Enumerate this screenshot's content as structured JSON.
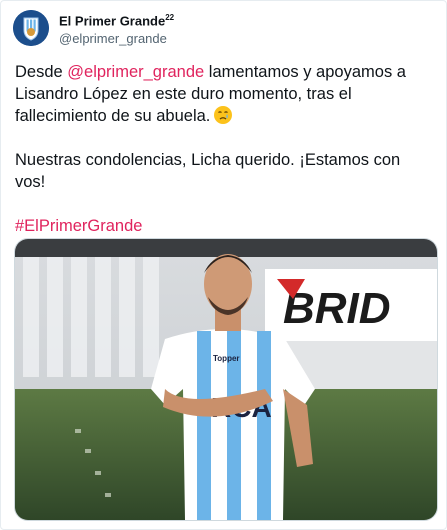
{
  "account": {
    "display_name": "El Primer Grande",
    "superscript": "22",
    "handle": "@elprimer_grande"
  },
  "tweet": {
    "line1_pre": "Desde ",
    "mention": "@elprimer_grande",
    "line1_post": " lamentamos y apoyamos a Lisandro López en este duro momento, tras el fallecimiento de su abuela.",
    "paragraph2": "Nuestras condolencias, Licha querido. ¡Estamos con vos!",
    "hashtag": "#ElPrimerGrande",
    "emoji": "crying-face-emoji"
  },
  "media": {
    "jersey_text": "RCA",
    "jersey_brand": "Topper",
    "banner_text": "BRID"
  },
  "colors": {
    "link_pink": "#e0245e",
    "handle_gray": "#536471",
    "jersey_blue": "#6cb4e8"
  }
}
